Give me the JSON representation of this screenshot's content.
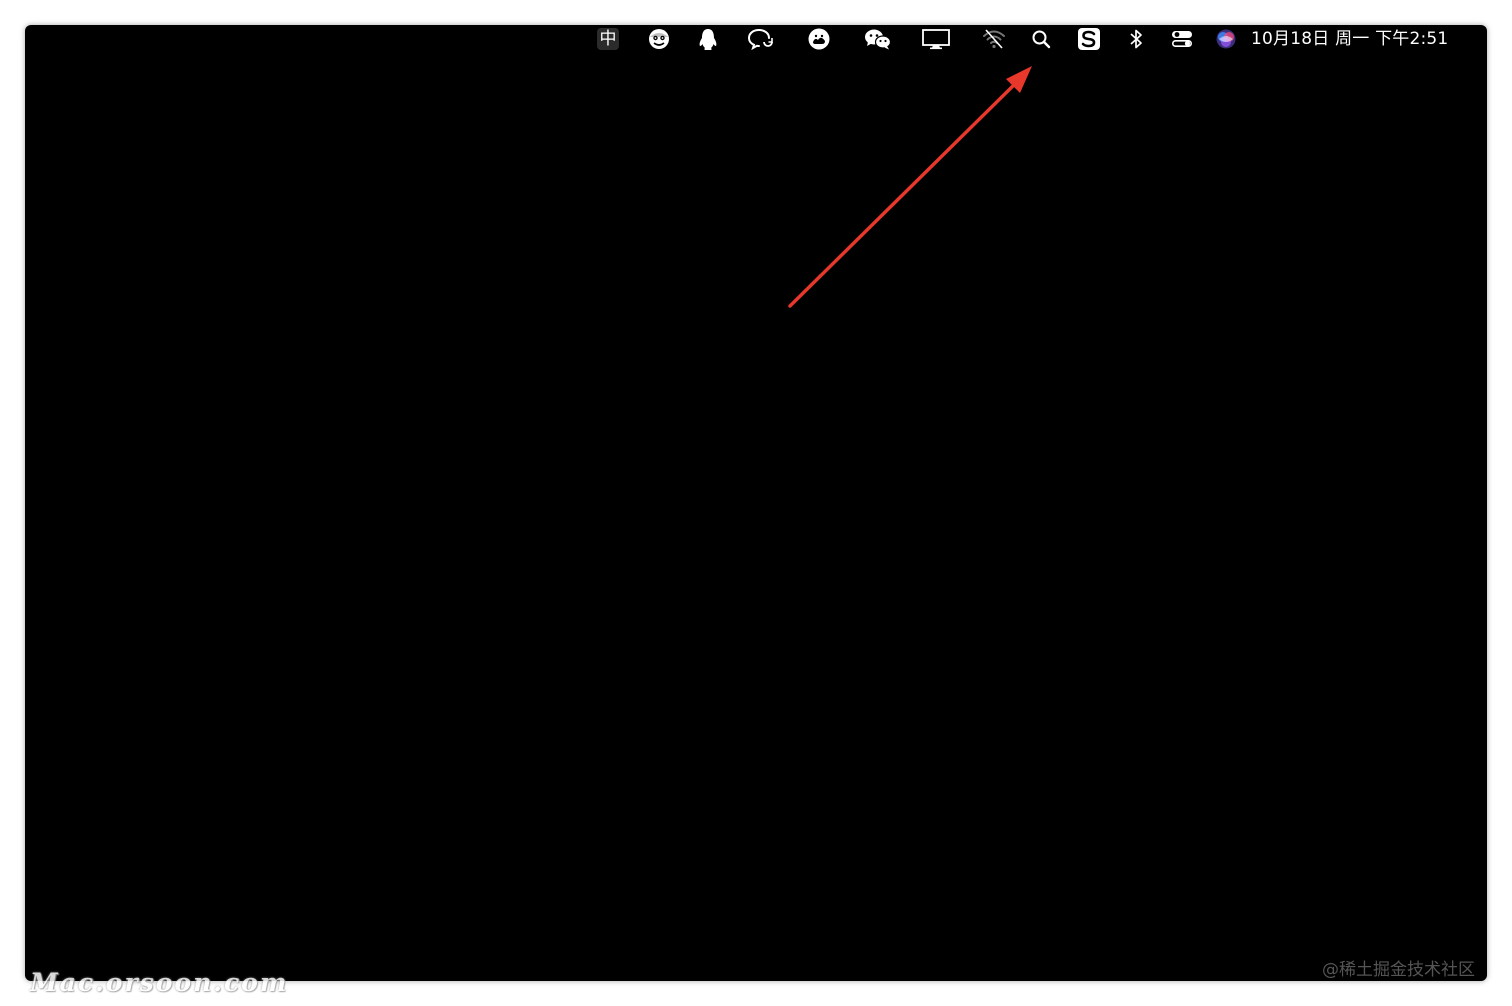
{
  "menubar": {
    "input_method_label": "中",
    "status_icons": [
      "input-method-icon",
      "face-app-icon",
      "qq-penguin-icon",
      "chat-refresh-icon",
      "cloud-face-icon",
      "wechat-icon",
      "display-monitor-icon",
      "wifi-off-icon",
      "search-icon",
      "sogou-s-icon",
      "bluetooth-icon",
      "control-center-icon",
      "siri-icon"
    ],
    "clock": "10月18日 周一 下午2:51"
  },
  "annotation": {
    "arrow_color": "#e8372b",
    "points_to": "search-icon"
  },
  "watermarks": {
    "left": "Mac.orsoon.com",
    "right": "@稀土掘金技术社区"
  },
  "colors": {
    "desktop": "#000000",
    "frame": "#ffffff",
    "menubar_text": "#ffffff"
  }
}
